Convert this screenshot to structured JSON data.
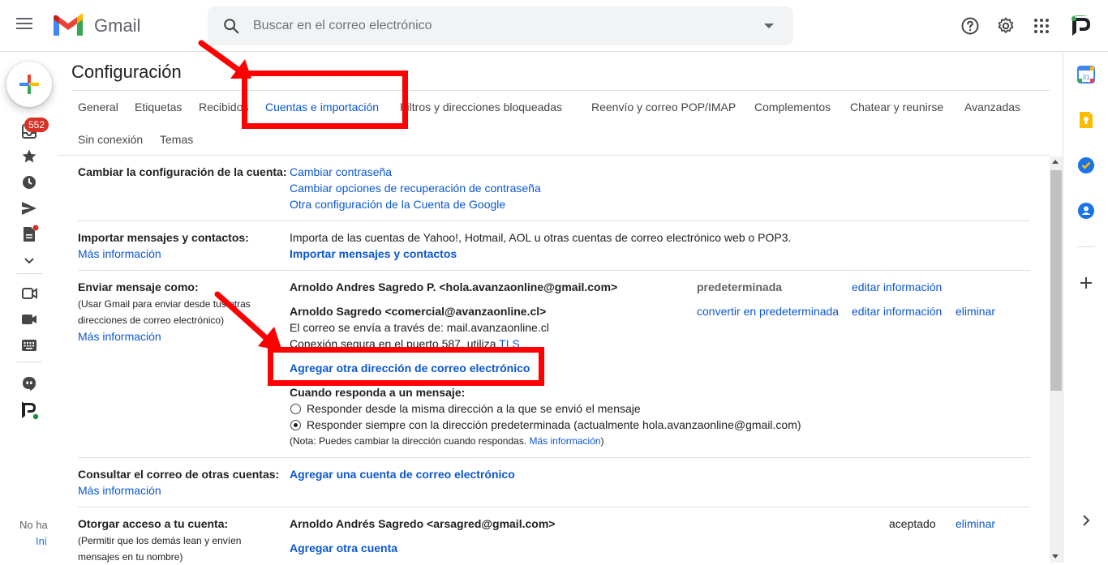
{
  "header": {
    "brand": "Gmail",
    "search_placeholder": "Buscar en el correo electrónico"
  },
  "rail": {
    "inbox_badge": "552",
    "no_text": "No ha",
    "ini_text": "Ini"
  },
  "settings": {
    "title": "Configuración",
    "tabs_row1": [
      "General",
      "Etiquetas",
      "Recibidos",
      "Cuentas e importación",
      "Filtros y direcciones bloqueadas",
      "Reenvío y correo POP/IMAP",
      "Complementos",
      "Chatear y reunirse",
      "Avanzadas"
    ],
    "tabs_row2": [
      "Sin conexión",
      "Temas"
    ],
    "active_tab": "Cuentas e importación"
  },
  "sections": {
    "cuenta": {
      "label": "Cambiar la configuración de la cuenta:",
      "links": [
        "Cambiar contraseña",
        "Cambiar opciones de recuperación de contraseña",
        "Otra configuración de la Cuenta de Google"
      ]
    },
    "importar": {
      "label": "Importar mensajes y contactos:",
      "more": "Más información",
      "desc": "Importa de las cuentas de Yahoo!, Hotmail, AOL u otras cuentas de correo electrónico web o POP3.",
      "action": "Importar mensajes y contactos"
    },
    "enviar": {
      "label": "Enviar mensaje como:",
      "sub1": "(Usar Gmail para enviar desde tus otras",
      "sub2": "direcciones de correo electrónico)",
      "more": "Más información",
      "addr1": "Arnoldo Andres Sagredo P. <hola.avanzaonline@gmail.com>",
      "addr1_status": "predeterminada",
      "addr1_edit": "editar información",
      "addr2": "Arnoldo Sagredo <comercial@avanzaonline.cl>",
      "addr2_make_default": "convertir en predeterminada",
      "addr2_edit": "editar información",
      "addr2_delete": "eliminar",
      "addr2_via": "El correo se envía a través de: mail.avanzaonline.cl",
      "addr2_conn": "Conexión segura en el puerto 587, utiliza",
      "addr2_tls": "TLS",
      "add_address": "Agregar otra dirección de correo electrónico",
      "reply_heading": "Cuando responda a un mensaje:",
      "reply_opt1": "Responder desde la misma dirección a la que se envió el mensaje",
      "reply_opt2": "Responder siempre con la dirección predeterminada (actualmente hola.avanzaonline@gmail.com)",
      "note": "(Nota: Puedes cambiar la dirección cuando respondas.",
      "note_link": "Más información",
      "note_end": ")"
    },
    "consultar": {
      "label": "Consultar el correo de otras cuentas:",
      "more": "Más información",
      "action": "Agregar una cuenta de correo electrónico"
    },
    "acceso": {
      "label": "Otorgar acceso a tu cuenta:",
      "sub1": "(Permitir que los demás lean y envíen",
      "sub2": "mensajes en tu nombre)",
      "account": "Arnoldo Andrés Sagredo <arsagred@gmail.com>",
      "status": "aceptado",
      "delete": "eliminar",
      "add": "Agregar otra cuenta"
    }
  },
  "colors": {
    "link": "#0b57d0",
    "highlight": "#ff0000",
    "badge": "#d93025"
  }
}
